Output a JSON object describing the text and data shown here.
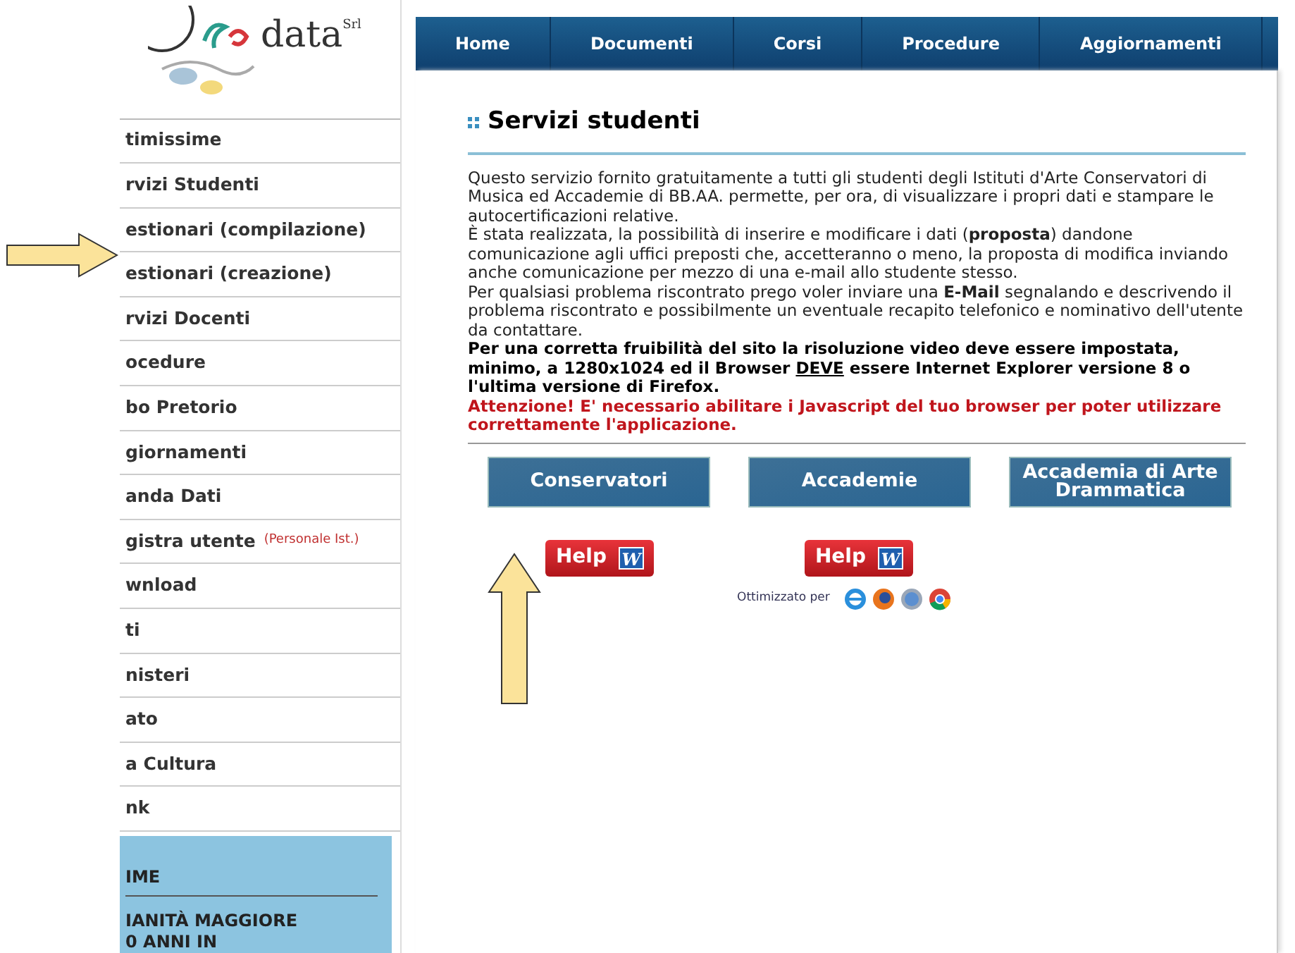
{
  "logo": {
    "text": "data",
    "suffix": "Srl"
  },
  "nav": [
    "Home",
    "Documenti",
    "Corsi",
    "Procedure",
    "Aggiornamenti"
  ],
  "sidebar": {
    "items": [
      {
        "label": "timissime"
      },
      {
        "label": "rvizi Studenti"
      },
      {
        "label": "estionari (compilazione)"
      },
      {
        "label": "estionari (creazione)"
      },
      {
        "label": "rvizi Docenti"
      },
      {
        "label": "ocedure"
      },
      {
        "label": "bo Pretorio"
      },
      {
        "label": "giornamenti"
      },
      {
        "label": "anda Dati"
      },
      {
        "label": "gistra utente",
        "note": "(Personale Ist.)"
      },
      {
        "label": "wnload"
      },
      {
        "label": "ti"
      },
      {
        "label": "nisteri"
      },
      {
        "label": "ato"
      },
      {
        "label": "a Cultura"
      },
      {
        "label": "nk"
      }
    ],
    "news": {
      "title": "IME",
      "lines": [
        "IANITÀ MAGGIORE",
        "0 ANNI IN"
      ]
    }
  },
  "main": {
    "title": "Servizi studenti",
    "paragraphs": [
      "Questo servizio fornito gratuitamente a tutti gli studenti degli Istituti d'Arte Conservatori di Musica ed Accademie di BB.AA. permette, per ora, di visualizzare i propri dati e stampare le autocertificazioni relative.",
      "È stata realizzata, la possibilità di inserire e modificare i dati (**proposta**) dandone comunicazione agli uffici preposti che, accetteranno o meno, la proposta di modifica inviando anche comunicazione per mezzo di una e-mail allo studente stesso.",
      "Per qualsiasi problema riscontrato prego voler inviare una **E-Mail** segnalando e descrivendo il problema riscontrato e possibilmente un eventuale recapito telefonico e nominativo dell'utente da contattare."
    ],
    "notice": {
      "before": "Per una corretta fruibilità del sito la risoluzione video deve essere impostata, minimo, a 1280x1024 ed il Browser ",
      "underlined": "DEVE",
      "after": " essere Internet Explorer versione 8 o l'ultima versione di Firefox."
    },
    "warning": "Attenzione! E' necessario abilitare i Javascript del tuo browser per poter utilizzare correttamente l'applicazione.",
    "buttons": [
      "Conservatori",
      "Accademie",
      "Accademia di Arte Drammatica"
    ],
    "help_buttons": [
      {
        "label": "Help",
        "icon_letter": "W"
      },
      {
        "label": "Help",
        "icon_letter": "W"
      }
    ],
    "optimized": "Ottimizzato per"
  }
}
